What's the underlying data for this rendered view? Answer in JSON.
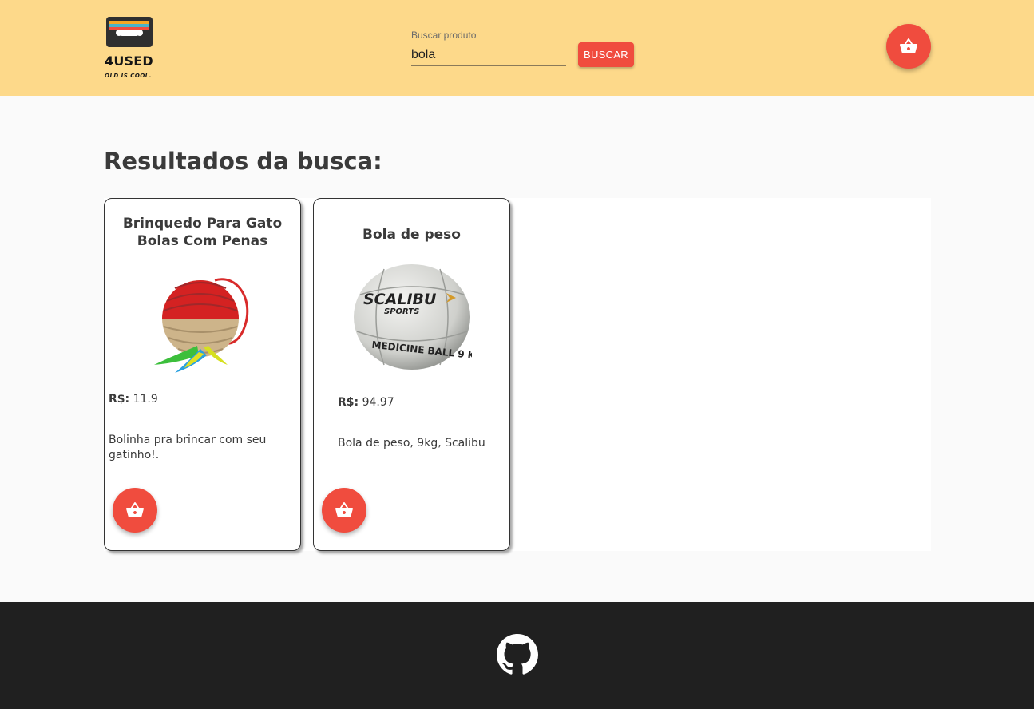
{
  "header": {
    "logo": {
      "name": "4USED",
      "tagline": "OLD IS COOL.",
      "icon": "cassette-tape-icon"
    },
    "search": {
      "label": "Buscar produto",
      "value": "bola",
      "button_label": "BUSCAR"
    },
    "cart_icon": "shopping-basket-icon"
  },
  "main": {
    "title": "Resultados da busca:",
    "products": [
      {
        "name": "Brinquedo Para Gato Bolas Com Penas",
        "price_label": "R$:",
        "price": "11.9",
        "description": "Bolinha pra brincar com seu gatinho!.",
        "cart_icon": "shopping-basket-icon"
      },
      {
        "name": "Bola de peso",
        "price_label": "R$:",
        "price": "94.97",
        "description": "Bola de peso, 9kg, Scalibu",
        "image_text": {
          "brand": "SCALIBU",
          "sub": "SPORTS",
          "label": "MEDICINE BALL 9 KG"
        },
        "cart_icon": "shopping-basket-icon"
      }
    ]
  },
  "footer": {
    "icon": "github-icon"
  },
  "colors": {
    "header_bg": "#fdd98a",
    "accent": "#f04c3e",
    "footer_bg": "#202020",
    "page_bg": "#fafafa"
  }
}
